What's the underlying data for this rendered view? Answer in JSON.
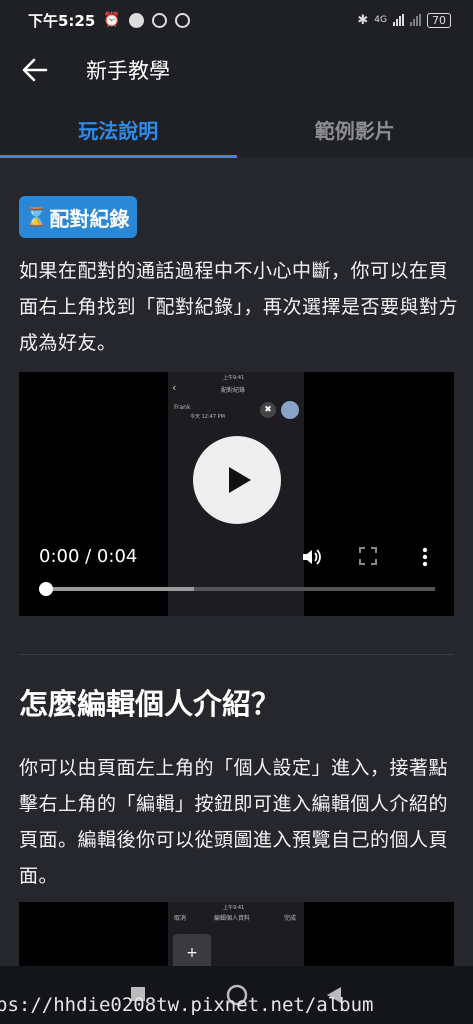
{
  "status_bar": {
    "time": "下午5:25",
    "network": "4G",
    "battery": "70"
  },
  "header": {
    "title": "新手教學"
  },
  "tabs": [
    {
      "label": "玩法說明",
      "active": true
    },
    {
      "label": "範例影片",
      "active": false
    }
  ],
  "section1": {
    "badge_icon": "hourglass-icon",
    "badge_label": "配對紀錄",
    "text": "如果在配對的通話過程中不小心中斷，你可以在頁面右上角找到「配對紀錄」，再次選擇是否要與對方成為好友。",
    "video": {
      "time": "0:00 / 0:04",
      "progress": 0,
      "buffered": 0.38,
      "preview_title": "配對紀錄",
      "preview_name": "Frank",
      "preview_status_time": "上午9:41",
      "preview_meta": "今天 12:47 PM"
    }
  },
  "section2": {
    "heading": "怎麼編輯個人介紹？",
    "text": "你可以由頁面左上角的「個人設定」進入，接著點擊右上角的「編輯」按鈕即可進入編輯個人介紹的頁面。編輯後你可以從頭圖進入預覽自己的個人頁面。",
    "video": {
      "preview_status_time": "上午9:41",
      "preview_cancel": "取消",
      "preview_title": "編輯個人資料",
      "preview_done": "完成"
    }
  },
  "watermark": "ps://hhdie0208tw.pixnet.net/album",
  "colors": {
    "accent": "#2f8be8",
    "badge": "#2a88d6",
    "background": "#26272c",
    "bar": "#1f2024"
  }
}
